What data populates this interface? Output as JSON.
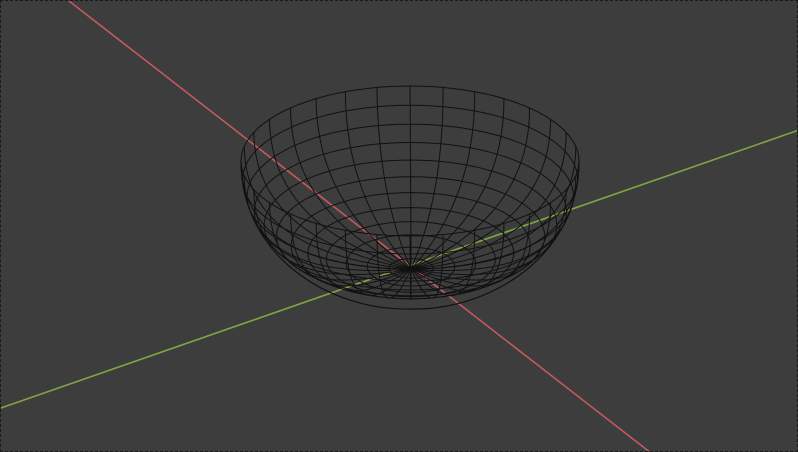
{
  "viewport": {
    "background": "#3d3d3d",
    "frame_style": "dashed"
  },
  "axes": {
    "x": {
      "color": "#c05a5e"
    },
    "y": {
      "color": "#7fa542"
    }
  },
  "object": {
    "type": "hemisphere-wireframe",
    "wire_color": "#111111",
    "rings": 12,
    "meridians": 32
  }
}
